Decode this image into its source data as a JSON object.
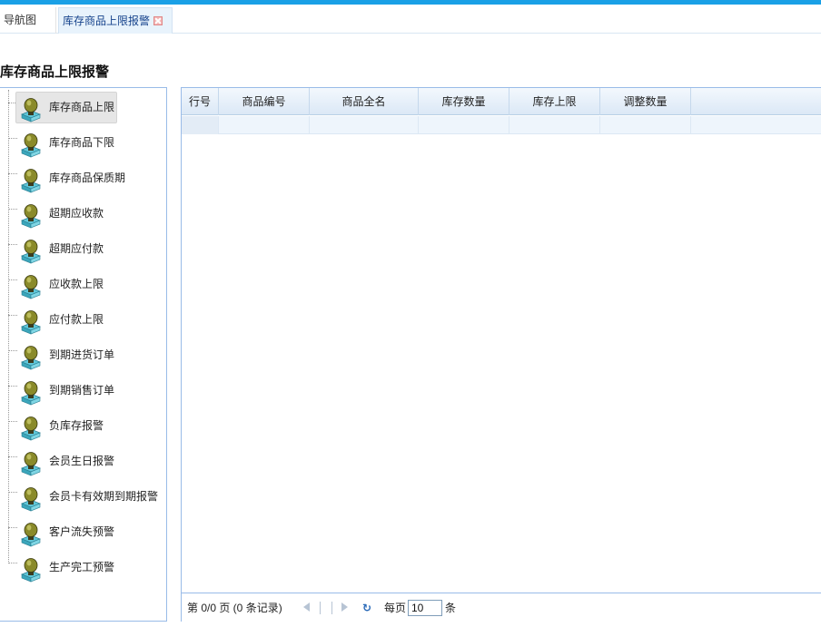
{
  "tabs": [
    {
      "label": "导航图"
    },
    {
      "label": "库存商品上限报警"
    }
  ],
  "page_title": "库存商品上限报警",
  "tree": {
    "items": [
      {
        "label": "库存商品上限",
        "selected": true
      },
      {
        "label": "库存商品下限"
      },
      {
        "label": "库存商品保质期"
      },
      {
        "label": "超期应收款"
      },
      {
        "label": "超期应付款"
      },
      {
        "label": "应收款上限"
      },
      {
        "label": "应付款上限"
      },
      {
        "label": "到期进货订单"
      },
      {
        "label": "到期销售订单"
      },
      {
        "label": "负库存报警"
      },
      {
        "label": "会员生日报警"
      },
      {
        "label": "会员卡有效期到期报警"
      },
      {
        "label": "客户流失预警"
      },
      {
        "label": "生产完工预警"
      }
    ],
    "icon": "lightbulb-icon"
  },
  "grid": {
    "columns": [
      "行号",
      "商品编号",
      "商品全名",
      "库存数量",
      "库存上限",
      "调整数量"
    ]
  },
  "pager": {
    "status": "第 0/0 页 (0 条记录)",
    "per_page_label": "每页",
    "page_size": "10",
    "unit_label": "条"
  },
  "colors": {
    "accent": "#1aa0e6",
    "border": "#99bbe8",
    "header_bg": "#dbe8f6"
  }
}
